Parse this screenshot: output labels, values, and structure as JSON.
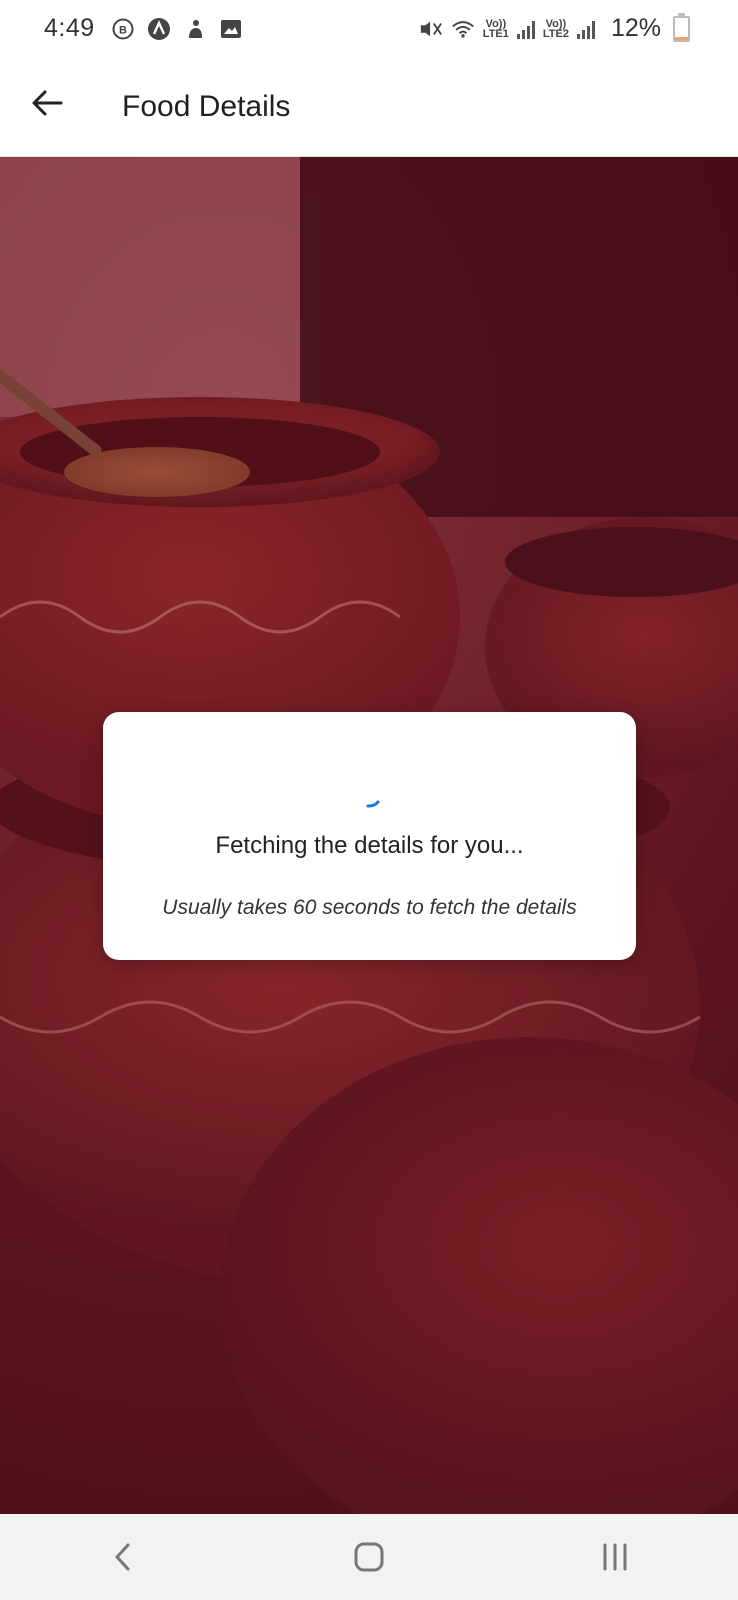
{
  "status_bar": {
    "time": "4:49",
    "left_icons": [
      "b-circle-icon",
      "a-circle-icon",
      "app-notification-icon",
      "image-icon"
    ],
    "lte1": "Vo))\nLTE1",
    "lte2": "Vo))\nLTE2",
    "battery_percent": "12%",
    "battery_level": 0.12
  },
  "app_bar": {
    "title": "Food Details"
  },
  "dialog": {
    "title": "Fetching the details for you...",
    "subtitle": "Usually takes 60 seconds to fetch the details"
  },
  "colors": {
    "accent_spinner": "#1a73e8",
    "overlay": "#6e222b",
    "nav_bg": "#f2f2f2"
  }
}
